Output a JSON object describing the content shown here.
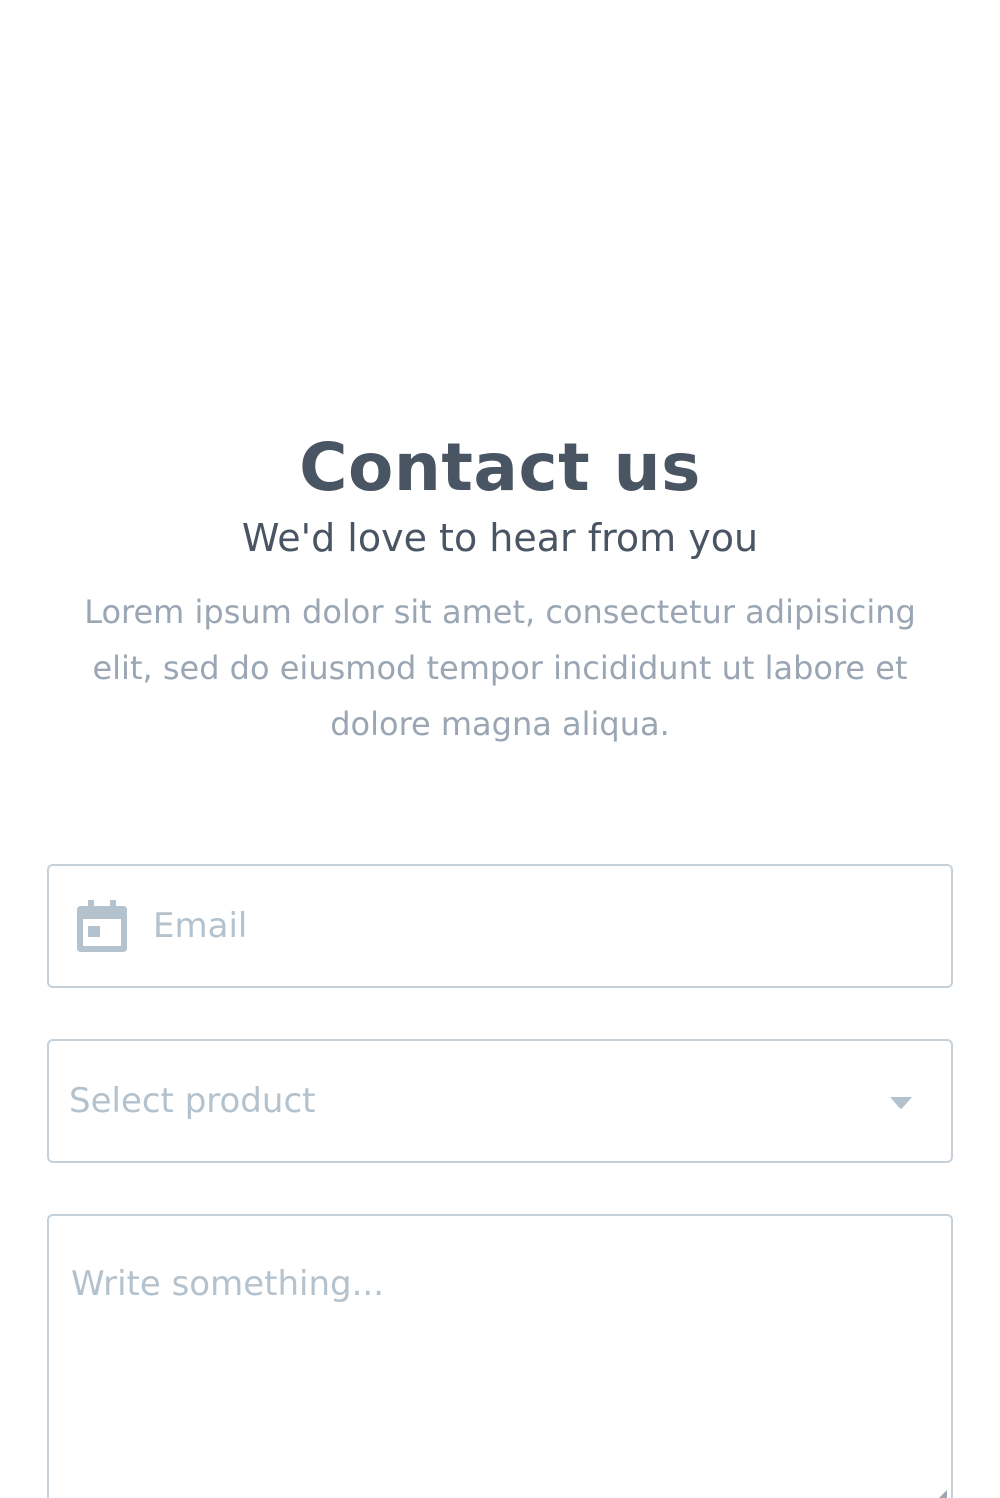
{
  "header": {
    "title": "Contact us",
    "subtitle": "We'd love to hear from you",
    "description": "Lorem ipsum dolor sit amet, consectetur adipisicing elit, sed do eiusmod tempor incididunt ut labore et dolore magna aliqua."
  },
  "form": {
    "email": {
      "placeholder": "Email",
      "value": "",
      "icon": "calendar-icon"
    },
    "product": {
      "placeholder": "Select product",
      "icon": "chevron-down-icon"
    },
    "message": {
      "placeholder": "Write something...",
      "value": ""
    }
  },
  "colors": {
    "heading": "#4a5563",
    "muted_text": "#9aa6b3",
    "placeholder": "#b4c2cd",
    "border": "#c6d0d9",
    "icon": "#b4c2cd",
    "background": "#ffffff"
  }
}
